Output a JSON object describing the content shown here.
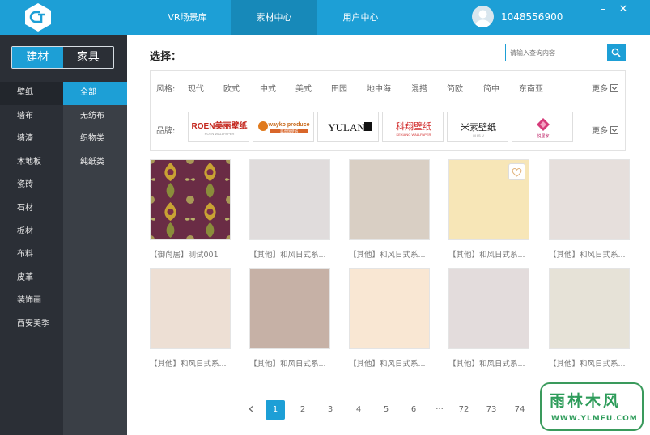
{
  "topbar": {
    "tabs": [
      {
        "label": "VR场景库",
        "active": false
      },
      {
        "label": "素材中心",
        "active": true
      },
      {
        "label": "用户中心",
        "active": false
      }
    ],
    "username": "1048556900",
    "minimize": "–",
    "close": "✕"
  },
  "sidebar": {
    "toggle": [
      {
        "label": "建材",
        "active": true
      },
      {
        "label": "家具",
        "active": false
      }
    ],
    "categories": [
      "壁纸",
      "墙布",
      "墙漆",
      "木地板",
      "瓷砖",
      "石材",
      "板材",
      "布料",
      "皮革",
      "装饰画",
      "西安美季"
    ],
    "subcategories": [
      "全部",
      "无纺布",
      "织物类",
      "纯纸类"
    ]
  },
  "main": {
    "select_title": "选择：",
    "search_placeholder": "请输入查询内容",
    "style_label": "风格:",
    "styles": [
      "现代",
      "欧式",
      "中式",
      "美式",
      "田园",
      "地中海",
      "混搭",
      "简欧",
      "简中",
      "东南亚"
    ],
    "brand_label": "品牌:",
    "brands": [
      "ROEN美丽壁纸",
      "wayko produce 美高瑞壁纸",
      "YULAN",
      "科翔壁纸",
      "米素壁纸",
      "悦居家"
    ],
    "more_label": "更多",
    "products": [
      {
        "caption": "【御尚居】测试001",
        "texture": "damask",
        "favorite": false
      },
      {
        "caption": "【其他】和风日式系...",
        "texture": "#e0dcdc",
        "favorite": false
      },
      {
        "caption": "【其他】和风日式系...",
        "texture": "#d9cfc4",
        "favorite": false
      },
      {
        "caption": "【其他】和风日式系...",
        "texture": "#f7e6b7",
        "favorite": true
      },
      {
        "caption": "【其他】和风日式系...",
        "texture": "#e6dfdc",
        "favorite": false
      },
      {
        "caption": "【其他】和风日式系...",
        "texture": "#eddfd4",
        "favorite": false
      },
      {
        "caption": "【其他】和风日式系...",
        "texture": "#c6b1a6",
        "favorite": false
      },
      {
        "caption": "【其他】和风日式系...",
        "texture": "#f9e7d3",
        "favorite": false
      },
      {
        "caption": "【其他】和风日式系...",
        "texture": "#e3dcdc",
        "favorite": false
      },
      {
        "caption": "【其他】和风日式系...",
        "texture": "#e6e2d7",
        "favorite": false
      }
    ]
  },
  "pagination": {
    "prev": "‹",
    "pages": [
      "1",
      "2",
      "3",
      "4",
      "5",
      "6"
    ],
    "ellipsis": "···",
    "tail_pages": [
      "72",
      "73",
      "74"
    ],
    "current": "1"
  },
  "watermark": {
    "main": "雨林木风",
    "sub": "WWW.YLMFU.COM"
  }
}
